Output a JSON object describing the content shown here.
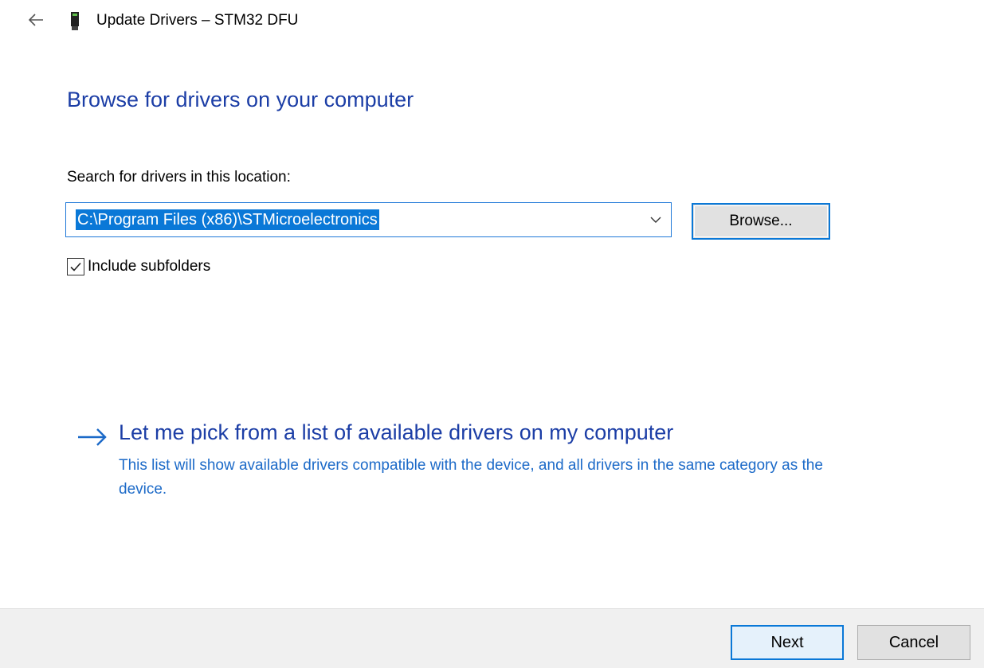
{
  "window": {
    "title": "Update Drivers – STM32 DFU",
    "back_icon": "arrow-left-icon",
    "device_icon": "usb-device-icon"
  },
  "main": {
    "heading": "Browse for drivers on your computer",
    "search_label": "Search for drivers in this location:",
    "path_value": "C:\\Program Files (x86)\\STMicroelectronics",
    "browse_label": "Browse...",
    "include_subfolders_label": "Include subfolders",
    "include_subfolders_checked": true
  },
  "pick_option": {
    "icon": "arrow-right-icon",
    "title": "Let me pick from a list of available drivers on my computer",
    "description": "This list will show available drivers compatible with the device, and all drivers in the same category as the device."
  },
  "footer": {
    "next_label": "Next",
    "cancel_label": "Cancel"
  },
  "colors": {
    "heading_blue": "#1c3ea6",
    "link_desc_blue": "#1c6ac8",
    "accent_blue": "#0a78d7",
    "footer_bg": "#f0f0f0"
  }
}
